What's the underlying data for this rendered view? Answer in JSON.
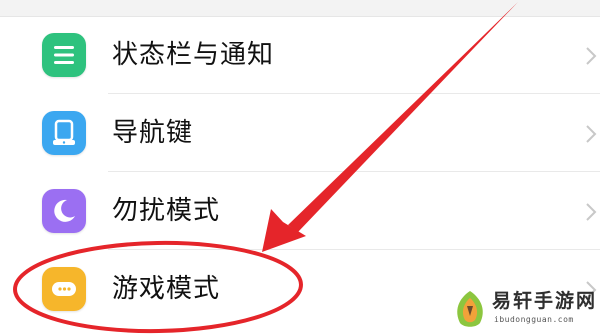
{
  "settings": {
    "items": [
      {
        "label": "状态栏与通知",
        "icon": "status-bar-notification-icon",
        "icon_color": "#2ec27e"
      },
      {
        "label": "导航键",
        "icon": "navigation-keys-icon",
        "icon_color": "#3ba7f0"
      },
      {
        "label": "勿扰模式",
        "icon": "do-not-disturb-moon-icon",
        "icon_color": "#9b6ff2"
      },
      {
        "label": "游戏模式",
        "icon": "game-mode-icon",
        "icon_color": "#f6b62b"
      }
    ]
  },
  "annotation": {
    "arrow_color": "#e5252a",
    "circle_color": "#e5252a",
    "highlighted_item": "游戏模式"
  },
  "watermark": {
    "brand": "易轩手游网",
    "domain": "ibudongguan.com",
    "logo_colors": [
      "#8cc63f",
      "#f2a23a",
      "#6b4a2b"
    ]
  }
}
